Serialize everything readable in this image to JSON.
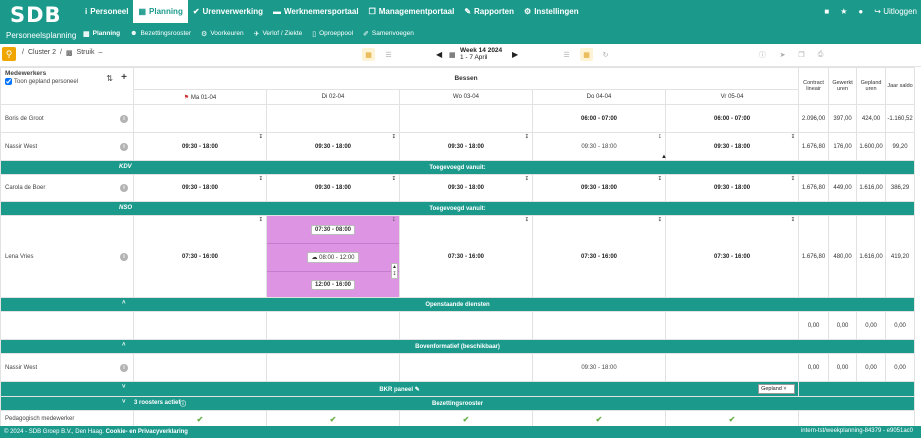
{
  "app": {
    "logo": "SDB",
    "subtitle": "Personeelsplanning"
  },
  "nav": [
    {
      "icon": "i",
      "label": "Personeel"
    },
    {
      "icon": "▦",
      "label": "Planning",
      "active": true
    },
    {
      "icon": "✔",
      "label": "Urenverwerking"
    },
    {
      "icon": "▬",
      "label": "Werknemersportaal"
    },
    {
      "icon": "❐",
      "label": "Managementportaal"
    },
    {
      "icon": "✎",
      "label": "Rapporten"
    },
    {
      "icon": "⚙",
      "label": "Instellingen"
    }
  ],
  "topright": {
    "logout": "Uitloggen"
  },
  "subnav": [
    {
      "icon": "▦",
      "label": "Planning",
      "active": true
    },
    {
      "icon": "☻",
      "label": "Bezettingsrooster"
    },
    {
      "icon": "⚙",
      "label": "Voorkeuren"
    },
    {
      "icon": "✈",
      "label": "Verlof / Ziekte"
    },
    {
      "icon": "▯",
      "label": "Oproeppool"
    },
    {
      "icon": "✐",
      "label": "Samenvoegen"
    }
  ],
  "breadcrumb": {
    "cluster": "Cluster 2",
    "unit": "Struik",
    "extra": "–"
  },
  "week": {
    "label": "Week 14 2024",
    "range": "1 - 7 April"
  },
  "grid": {
    "employees_header": "Medewerkers",
    "show_planned": "Toon gepland personeel",
    "location": "Bessen",
    "days": [
      "Ma 01-04",
      "Di 02-04",
      "Wo 03-04",
      "Do 04-04",
      "Vr 05-04"
    ],
    "totals": [
      "Contract lineair",
      "Gewerkt uren",
      "Gepland uren",
      "Jaar saldo"
    ],
    "rows": [
      {
        "name": "Boris de Groot",
        "shifts": [
          "",
          "",
          "",
          "06:00 - 07:00",
          "06:00 - 07:00"
        ],
        "nums": [
          "2.096,00",
          "397,00",
          "424,00",
          "-1.160,52"
        ]
      },
      {
        "name": "Nassir West",
        "shifts": [
          "09:30 - 18:00",
          "09:30 - 18:00",
          "09:30 - 18:00",
          "09:30 - 18:00",
          "09:30 - 18:00"
        ],
        "nums": [
          "1.676,80",
          "176,00",
          "1.600,00",
          "99,20"
        ]
      }
    ],
    "added1": {
      "label": "Toegevoegd vanuit:",
      "code": "KDV"
    },
    "rows2": [
      {
        "name": "Carola de Boer",
        "shifts": [
          "09:30 - 18:00",
          "09:30 - 18:00",
          "09:30 - 18:00",
          "09:30 - 18:00",
          "09:30 - 18:00"
        ],
        "nums": [
          "1.676,80",
          "449,00",
          "1.616,00",
          "386,29"
        ]
      }
    ],
    "added2": {
      "label": "Toegevoegd vanuit:",
      "code": "NSO"
    },
    "lena": {
      "name": "Lena Vries",
      "mon": "07:30 - 16:00",
      "tue": [
        "07:30 - 08:00",
        "08:00 - 12:00",
        "12:00 - 16:00"
      ],
      "wed": "07:30 - 16:00",
      "thu": "07:30 - 16:00",
      "fri": "07:30 - 16:00",
      "nums": [
        "1.676,80",
        "480,00",
        "1.616,00",
        "419,20"
      ]
    },
    "open": {
      "label": "Openstaande diensten",
      "nums": [
        "0,00",
        "0,00",
        "0,00",
        "0,00"
      ]
    },
    "boven": {
      "label": "Bovenformatief (beschikbaar)"
    },
    "boven_row": {
      "name": "Nassir West",
      "thu": "09:30 - 18:00",
      "nums": [
        "0,00",
        "0,00",
        "0,00",
        "0,00"
      ]
    },
    "bkr": {
      "label": "BKR paneel",
      "select": "Gepland"
    },
    "bezetting": {
      "label": "Bezettingsrooster",
      "active": "3 roosters actief"
    },
    "ped": {
      "name": "Pedagogisch medewerker"
    }
  },
  "footer": {
    "copyright": "© 2024 - SDB Groep B.V., Den Haag.",
    "link": "Cookie- en Privacyverklaring",
    "version": "intern-tst/weekplanning-84379 - e9051ac0"
  },
  "colors": {
    "brand": "#1b9a8c",
    "accent": "#f0a500",
    "split_shift": "#dc94e3"
  }
}
